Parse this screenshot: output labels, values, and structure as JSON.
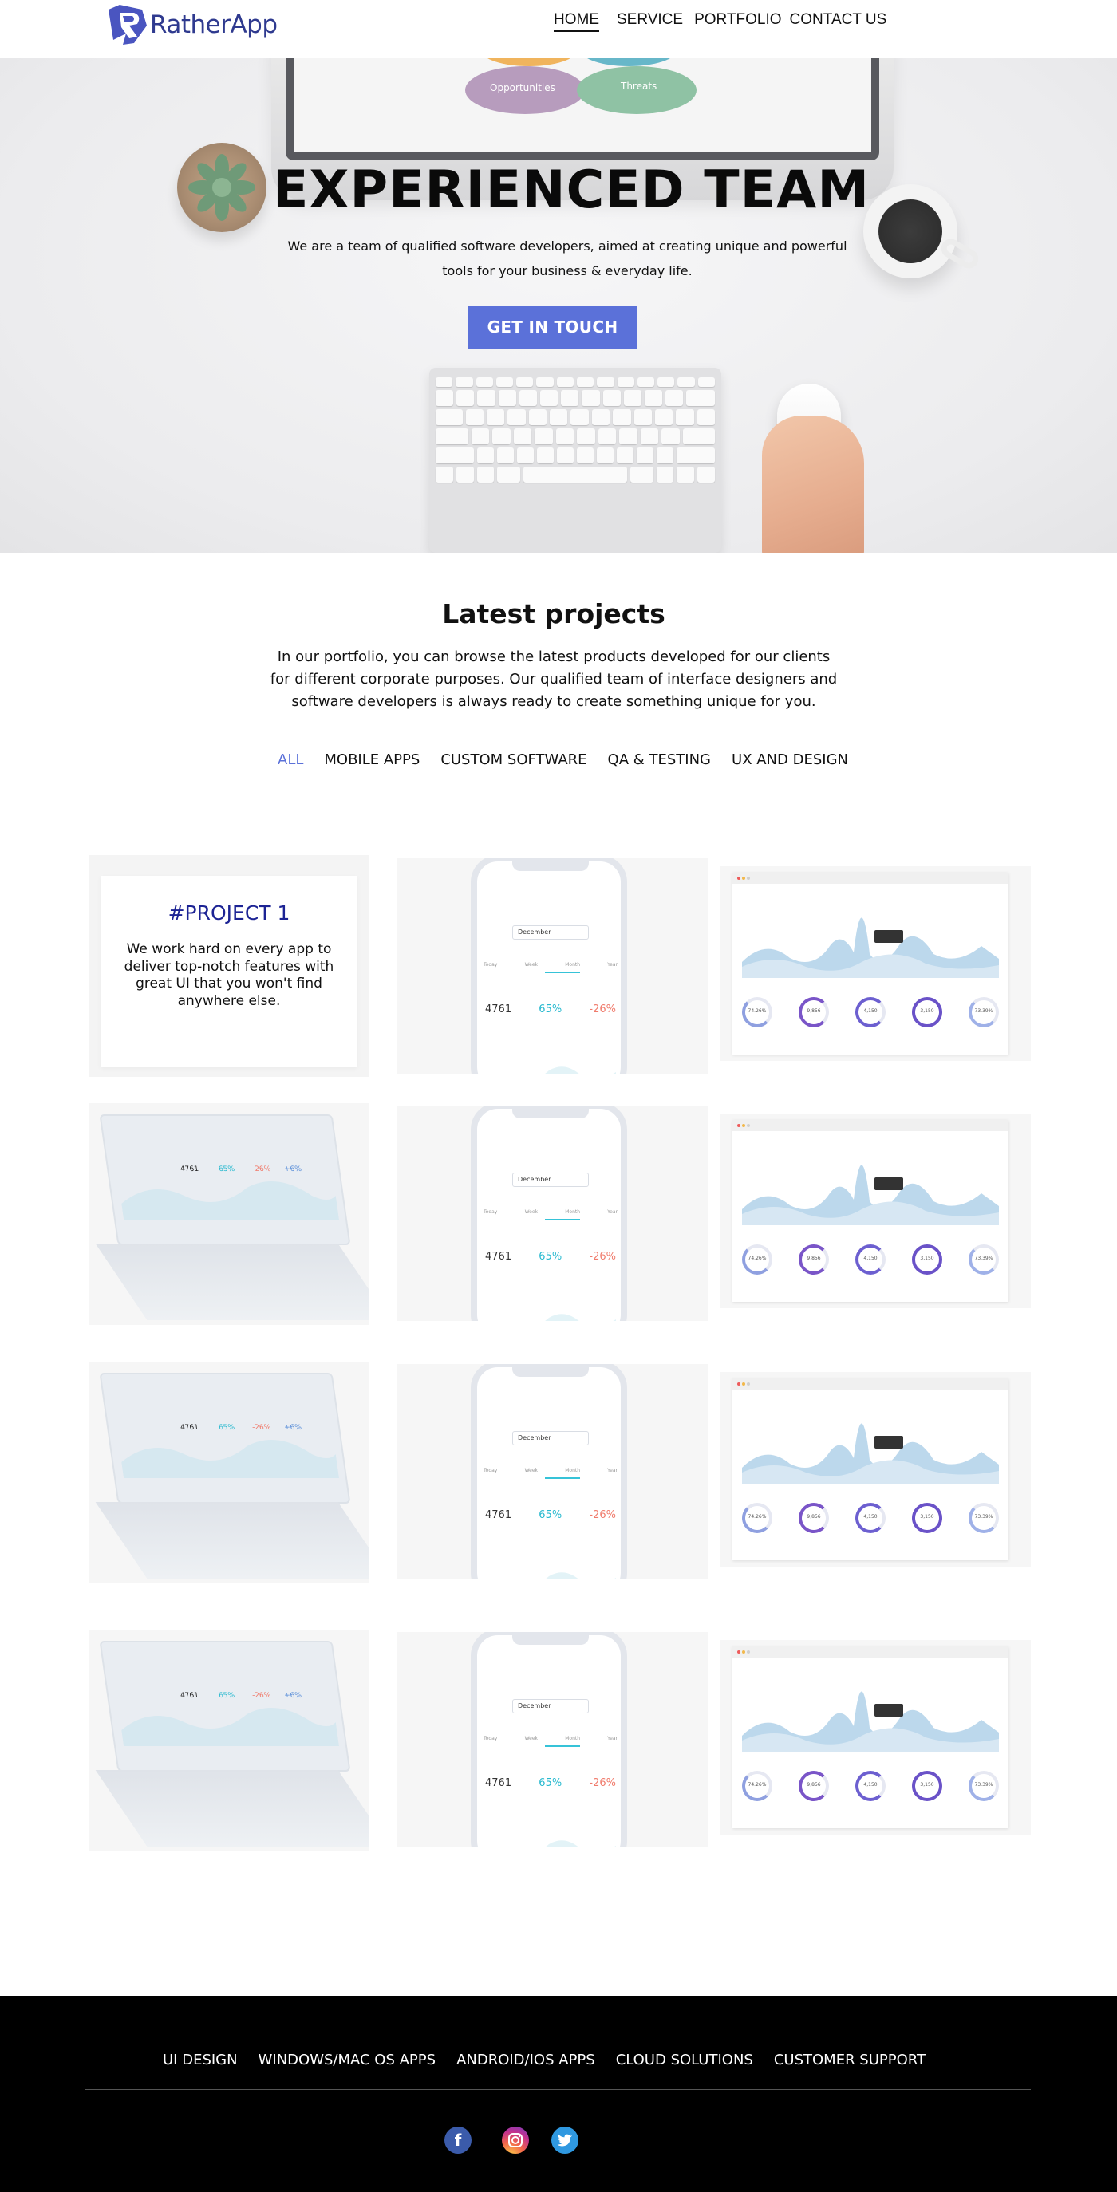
{
  "header": {
    "brand": "RatherApp",
    "nav": [
      {
        "label": "HOME",
        "active": true
      },
      {
        "label": "SERVICE",
        "active": false
      },
      {
        "label": "PORTFOLIO",
        "active": false
      },
      {
        "label": "CONTACT US",
        "active": false
      }
    ]
  },
  "hero": {
    "title": "EXPERIENCED TEAM",
    "subtitle": "We are a team of qualified software developers, aimed at creating unique and powerful tools for your business & everyday life.",
    "cta_label": "GET IN TOUCH",
    "monitor_labels": [
      "Opportunities",
      "Threats"
    ]
  },
  "projects": {
    "title": "Latest projects",
    "intro": "In our portfolio, you can browse the latest products developed for our clients for different corporate purposes. Our qualified team of interface designers and software developers is always ready to create something unique for you.",
    "filters": [
      {
        "label": "ALL",
        "active": true
      },
      {
        "label": "MOBILE APPS",
        "active": false
      },
      {
        "label": "CUSTOM SOFTWARE",
        "active": false
      },
      {
        "label": "QA & TESTING",
        "active": false
      },
      {
        "label": "UX AND DESIGN",
        "active": false
      }
    ],
    "featured": {
      "title": "#PROJECT 1",
      "text": "We work hard on every app to deliver top-notch features with great UI that you won't find anywhere else."
    },
    "phone_mock": {
      "select": "December",
      "tabs": [
        "Today",
        "Week",
        "Month",
        "Year"
      ],
      "stats": [
        "4761",
        "65%",
        "-26%"
      ]
    },
    "laptop_mock": {
      "stats": [
        "4761",
        "65%",
        "-26%",
        "+6%"
      ]
    },
    "dashboard_mock": {
      "rings": [
        "74.26%",
        "9,856",
        "4,150",
        "3,150",
        "73.39%"
      ]
    }
  },
  "footer": {
    "links": [
      "UI DESIGN",
      "WINDOWS/MAC OS APPS",
      "ANDROID/IOS APPS",
      "CLOUD SOLUTIONS",
      "CUSTOMER SUPPORT"
    ],
    "social": [
      {
        "icon": "facebook-icon",
        "glyph": "f",
        "color": "#3b5baa"
      },
      {
        "icon": "instagram-icon",
        "glyph": "◎",
        "color": "#c2318f"
      },
      {
        "icon": "twitter-icon",
        "glyph": "t",
        "color": "#2f98e0"
      }
    ]
  },
  "colors": {
    "accent": "#5b71d9",
    "brand": "#2f3a8f",
    "featured_title": "#1c2394",
    "footer_bg": "#000000"
  }
}
